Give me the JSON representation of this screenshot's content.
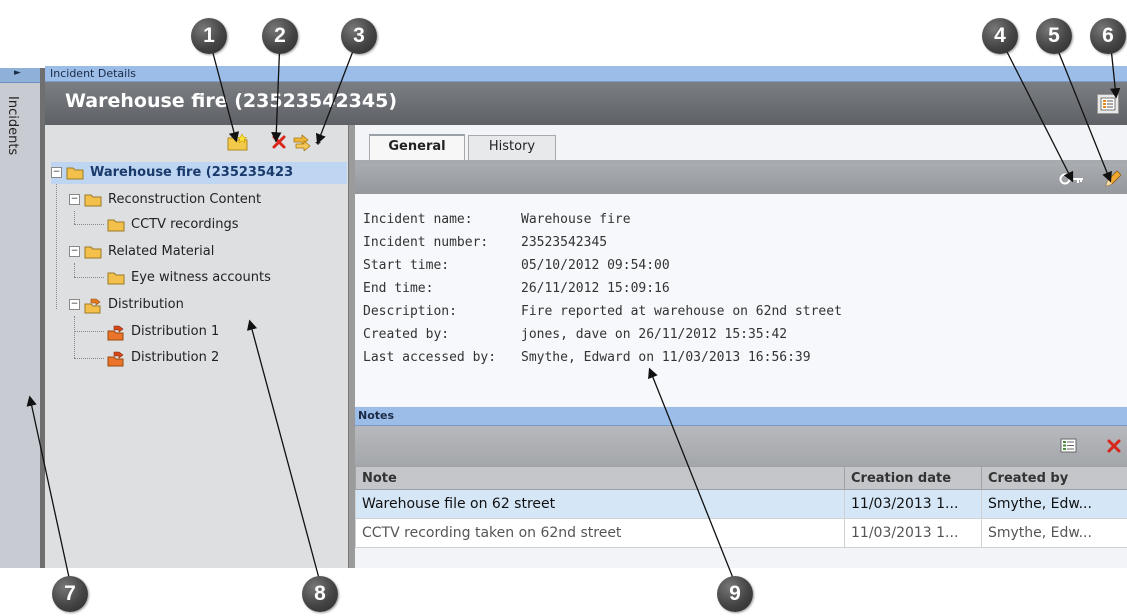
{
  "callouts": [
    "1",
    "2",
    "3",
    "4",
    "5",
    "6",
    "7",
    "8",
    "9"
  ],
  "sidebar": {
    "label": "Incidents"
  },
  "details_bar": {
    "title": "Incident Details"
  },
  "header": {
    "title": "Warehouse fire (23523542345)"
  },
  "tree": {
    "items": [
      {
        "label": "Warehouse fire (235235423",
        "level": 0,
        "icon": "folder-icon",
        "selected": true
      },
      {
        "label": "Reconstruction Content",
        "level": 1,
        "icon": "folder-icon"
      },
      {
        "label": "CCTV recordings",
        "level": 2,
        "icon": "folder-icon"
      },
      {
        "label": "Related Material",
        "level": 1,
        "icon": "folder-icon"
      },
      {
        "label": "Eye witness accounts",
        "level": 2,
        "icon": "folder-icon"
      },
      {
        "label": "Distribution",
        "level": 1,
        "icon": "distribution-icon"
      },
      {
        "label": "Distribution 1",
        "level": 2,
        "icon": "distribution-icon"
      },
      {
        "label": "Distribution 2",
        "level": 2,
        "icon": "distribution-icon"
      }
    ]
  },
  "tabs": [
    {
      "label": "General",
      "active": true
    },
    {
      "label": "History",
      "active": false
    }
  ],
  "info": {
    "labels": [
      "Incident name:",
      "Incident number:",
      "Start time:",
      "End time:",
      "Description:",
      "Created by:",
      "Last accessed by:"
    ],
    "values": [
      "Warehouse fire",
      "23523542345",
      "05/10/2012 09:54:00",
      "26/11/2012 15:09:16",
      "Fire reported at warehouse on 62nd street",
      "jones, dave on 26/11/2012 15:35:42",
      "Smythe, Edward on 11/03/2013 16:56:39"
    ]
  },
  "notes": {
    "title": "Notes",
    "columns": [
      "Note",
      "Creation date",
      "Created by"
    ],
    "rows": [
      [
        "Warehouse file on 62 street",
        "11/03/2013 1...",
        "Smythe, Edw..."
      ],
      [
        "CCTV recording taken on 62nd street",
        "11/03/2013 1...",
        "Smythe, Edw..."
      ]
    ]
  },
  "colors": {
    "header_bg": "#65686d",
    "title_bar": "#9cbde8",
    "selection": "#bfd6f2",
    "delete_red": "#d9261c"
  }
}
